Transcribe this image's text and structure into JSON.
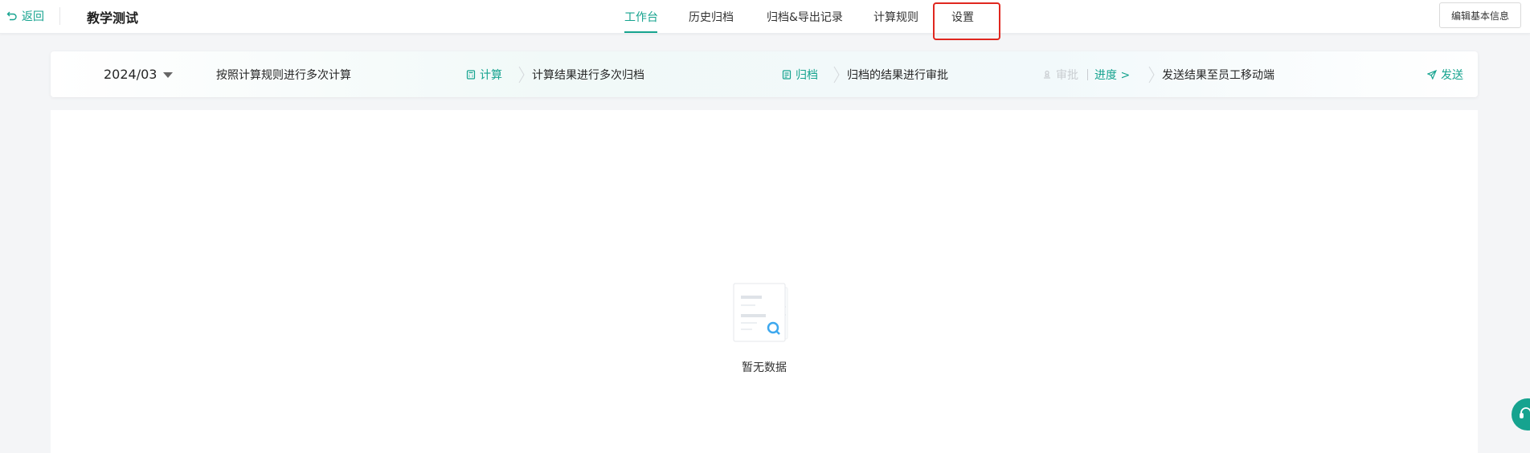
{
  "header": {
    "back_label": "返回",
    "title": "教学测试",
    "tabs": [
      {
        "label": "工作台",
        "active": true
      },
      {
        "label": "历史归档",
        "active": false
      },
      {
        "label": "归档&导出记录",
        "active": false
      },
      {
        "label": "计算规则",
        "active": false
      },
      {
        "label": "设置",
        "active": false
      }
    ],
    "edit_button": "编辑基本信息"
  },
  "flow": {
    "period": "2024/03",
    "step1": "按照计算规则进行多次计算",
    "calc_action": "计算",
    "step2": "计算结果进行多次归档",
    "archive_action": "归档",
    "step3": "归档的结果进行审批",
    "approve_action": "审批",
    "progress_action": "进度 >",
    "step4": "发送结果至员工移动端",
    "send_action": "发送"
  },
  "empty": {
    "text": "暂无数据"
  },
  "colors": {
    "accent": "#16a38f",
    "highlight": "#e0271f",
    "disabled": "#c8ccd0"
  }
}
